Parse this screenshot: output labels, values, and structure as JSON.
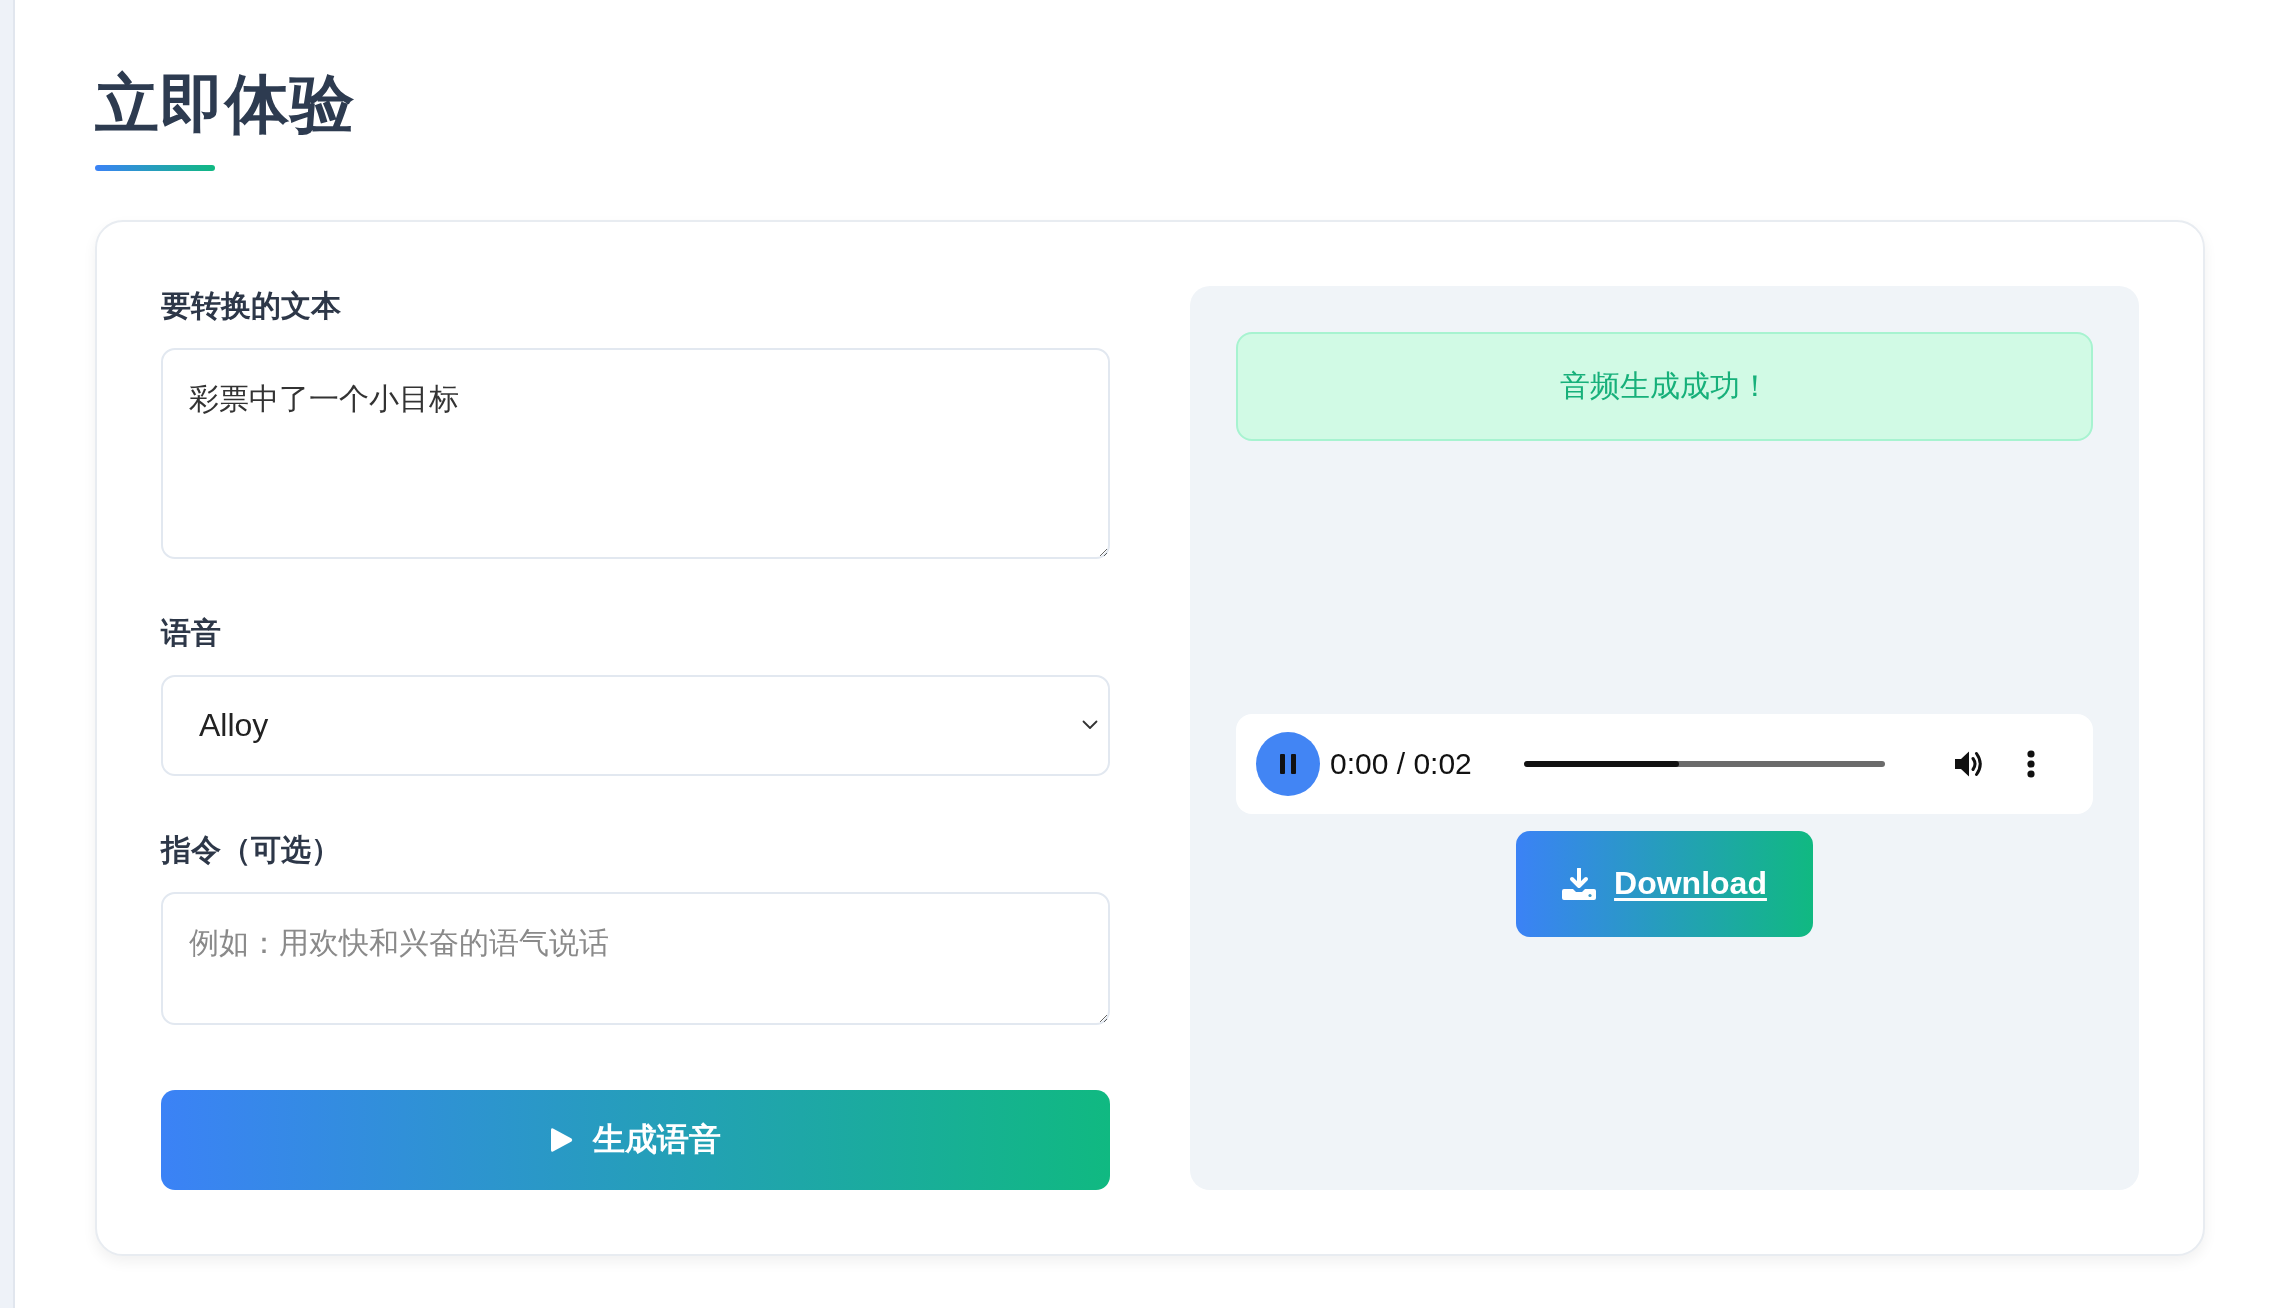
{
  "page": {
    "title": "立即体验"
  },
  "form": {
    "fields": [
      {
        "kind": "textarea",
        "label": "要转换的文本",
        "value": "彩票中了一个小目标"
      },
      {
        "kind": "select",
        "label": "语音",
        "value": "Alloy"
      },
      {
        "kind": "textarea",
        "label": "指令（可选）",
        "placeholder": "例如：用欢快和兴奋的语气说话"
      }
    ],
    "submit_button": {
      "label": "生成语音"
    }
  },
  "result": {
    "status": {
      "kind": "success",
      "message": "音频生成成功！"
    },
    "player": {
      "playing": true,
      "time": "0:00 / 0:02",
      "level": 0.43
    },
    "download_button": {
      "label": "Download"
    }
  }
}
